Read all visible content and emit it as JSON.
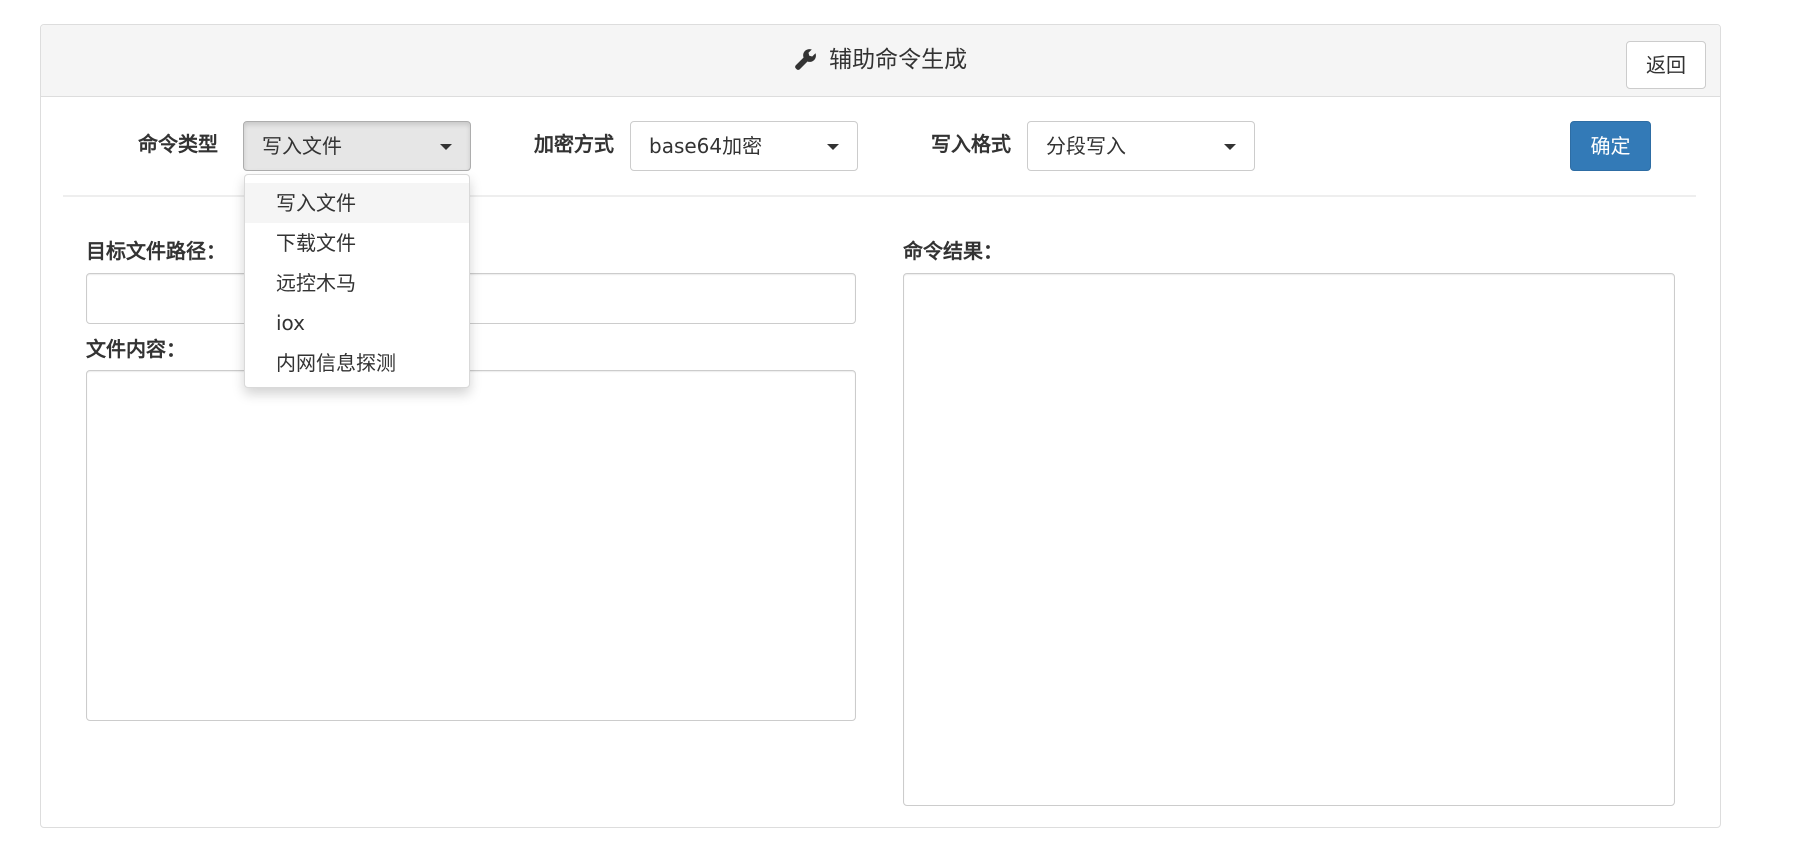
{
  "header": {
    "title": "辅助命令生成",
    "icon": "wrench-icon",
    "back_label": "返回"
  },
  "toolbar": {
    "command_type_label": "命令类型",
    "command_type_value": "写入文件",
    "encrypt_label": "加密方式",
    "encrypt_value": "base64加密",
    "write_format_label": "写入格式",
    "write_format_value": "分段写入",
    "confirm_label": "确定"
  },
  "command_type_options": [
    "写入文件",
    "下载文件",
    "远控木马",
    "iox",
    "内网信息探测"
  ],
  "form": {
    "target_path_label": "目标文件路径：",
    "target_path_value": "",
    "file_content_label": "文件内容：",
    "file_content_value": "",
    "result_label": "命令结果：",
    "result_value": ""
  },
  "colors": {
    "primary": "#337ab7",
    "heading_bg": "#f5f5f5",
    "border": "#cccccc"
  }
}
